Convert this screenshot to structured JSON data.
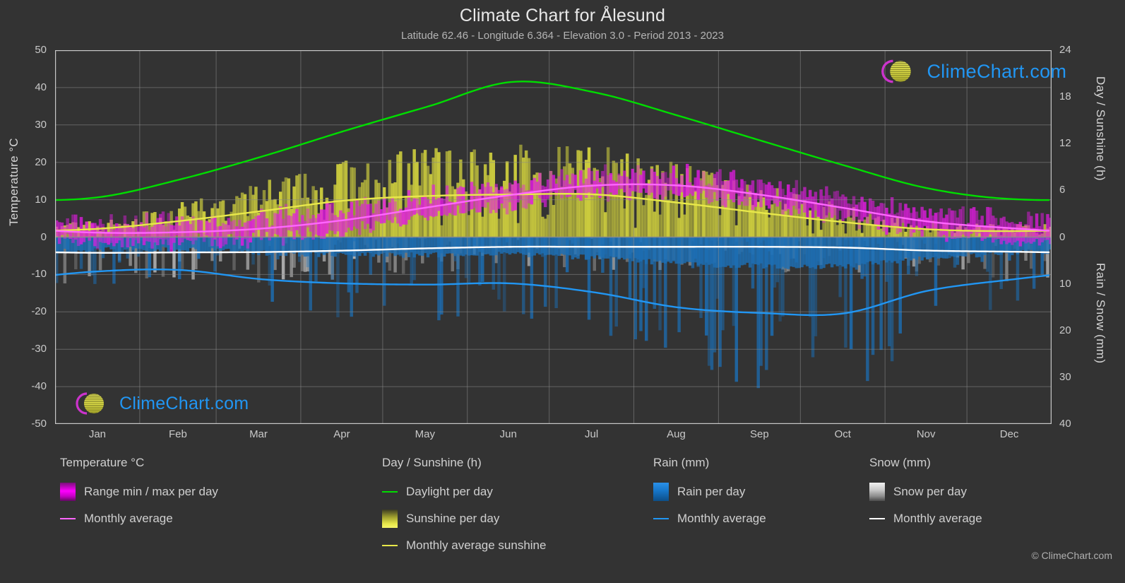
{
  "header": {
    "title": "Climate Chart for Ålesund",
    "subtitle": "Latitude 62.46 - Longitude 6.364 - Elevation 3.0 - Period 2013 - 2023"
  },
  "axes": {
    "left_title": "Temperature °C",
    "right_title_top": "Day / Sunshine (h)",
    "right_title_bottom": "Rain / Snow (mm)",
    "left_ticks": [
      "50",
      "40",
      "30",
      "20",
      "10",
      "0",
      "-10",
      "-20",
      "-30",
      "-40",
      "-50"
    ],
    "right_ticks_top": [
      "24",
      "18",
      "12",
      "6",
      "0"
    ],
    "right_ticks_bottom": [
      "10",
      "20",
      "30",
      "40"
    ],
    "x_ticks": [
      "Jan",
      "Feb",
      "Mar",
      "Apr",
      "May",
      "Jun",
      "Jul",
      "Aug",
      "Sep",
      "Oct",
      "Nov",
      "Dec"
    ]
  },
  "legend": {
    "temperature": {
      "heading": "Temperature °C",
      "items": [
        {
          "label": "Range min / max per day",
          "type": "swatch",
          "color": "#ff00ff"
        },
        {
          "label": "Monthly average",
          "type": "line",
          "color": "#ff66ff"
        }
      ]
    },
    "daysun": {
      "heading": "Day / Sunshine (h)",
      "items": [
        {
          "label": "Daylight per day",
          "type": "line",
          "color": "#00dd00"
        },
        {
          "label": "Sunshine per day",
          "type": "swatch",
          "color": "#e8e84a"
        },
        {
          "label": "Monthly average sunshine",
          "type": "line",
          "color": "#e8e84a"
        }
      ]
    },
    "rain": {
      "heading": "Rain (mm)",
      "items": [
        {
          "label": "Rain per day",
          "type": "swatch",
          "color": "#1e88e5"
        },
        {
          "label": "Monthly average",
          "type": "line",
          "color": "#2196f3"
        }
      ]
    },
    "snow": {
      "heading": "Snow (mm)",
      "items": [
        {
          "label": "Snow per day",
          "type": "swatch",
          "color": "#dddddd"
        },
        {
          "label": "Monthly average",
          "type": "line",
          "color": "#ffffff"
        }
      ]
    },
    "copyright": "© ClimeChart.com"
  },
  "watermark": {
    "text": "ClimeChart.com"
  },
  "chart_data": {
    "type": "line",
    "title": "Climate Chart for Ålesund",
    "subtitle": "Latitude 62.46 - Longitude 6.364 - Elevation 3.0 - Period 2013 - 2023",
    "xlabel": "",
    "ylabel": "Temperature °C",
    "ylim": [
      -50,
      50
    ],
    "y2lim_top_hours": [
      0,
      24
    ],
    "y2lim_bottom_mm": [
      0,
      40
    ],
    "grid": true,
    "legend_position": "below",
    "categories": [
      "Jan",
      "Feb",
      "Mar",
      "Apr",
      "May",
      "Jun",
      "Jul",
      "Aug",
      "Sep",
      "Oct",
      "Nov",
      "Dec"
    ],
    "series": [
      {
        "name": "Daylight per day",
        "unit": "h",
        "color": "#00dd00",
        "axis": "right-top",
        "values_hours": [
          5.1,
          7.4,
          10.4,
          13.7,
          16.8,
          19.9,
          18.6,
          15.6,
          12.4,
          9.2,
          6.3,
          4.9
        ],
        "values_celsius_scale": [
          10.6,
          15.4,
          21.6,
          28.5,
          35.0,
          41.5,
          38.7,
          32.5,
          25.8,
          19.2,
          13.1,
          10.2
        ]
      },
      {
        "name": "Monthly average sunshine",
        "unit": "h",
        "color": "#e8e84a",
        "axis": "right-top",
        "values_hours": [
          1.1,
          2.1,
          3.3,
          4.7,
          5.3,
          5.5,
          5.5,
          4.4,
          3.1,
          1.9,
          1.0,
          0.8
        ],
        "values_celsius_scale": [
          2.2,
          4.3,
          7.0,
          9.8,
          11.0,
          11.4,
          11.4,
          9.2,
          6.5,
          4.0,
          2.1,
          1.6
        ]
      },
      {
        "name": "Monthly average temperature",
        "unit": "°C",
        "color": "#ff66ff",
        "axis": "left",
        "values": [
          1.2,
          1.3,
          2.3,
          4.6,
          8.0,
          11.3,
          13.8,
          13.8,
          11.3,
          7.8,
          4.2,
          2.4
        ]
      },
      {
        "name": "Monthly average rain",
        "unit": "mm",
        "color": "#2196f3",
        "axis": "right-bottom",
        "values_mm": [
          4.9,
          4.7,
          6.0,
          6.6,
          6.8,
          6.6,
          7.9,
          11.3,
          13.7,
          13.8,
          8.4,
          5.8
        ],
        "values_celsius_scale": [
          -9.2,
          -8.8,
          -11.3,
          -12.4,
          -12.7,
          -12.4,
          -14.8,
          -18.8,
          -20.3,
          -20.4,
          -14.4,
          -11.4
        ]
      },
      {
        "name": "Monthly average snow",
        "unit": "mm",
        "color": "#ffffff",
        "axis": "right-bottom",
        "values_mm": [
          2.3,
          2.3,
          2.2,
          1.9,
          1.5,
          1.3,
          1.3,
          1.3,
          1.3,
          1.4,
          1.9,
          2.1
        ],
        "values_celsius_scale": [
          -4.2,
          -4.1,
          -4.0,
          -3.6,
          -3.0,
          -2.6,
          -2.6,
          -2.6,
          -2.6,
          -2.8,
          -3.6,
          -3.9
        ]
      }
    ],
    "daily_bands": [
      {
        "name": "Range min / max per day",
        "color": "#ff00ff",
        "axis": "left"
      },
      {
        "name": "Sunshine per day",
        "color": "#e8e84a",
        "axis": "right-top"
      },
      {
        "name": "Rain per day",
        "color": "#1e88e5",
        "axis": "right-bottom"
      },
      {
        "name": "Snow per day",
        "color": "#dddddd",
        "axis": "right-bottom"
      }
    ]
  }
}
